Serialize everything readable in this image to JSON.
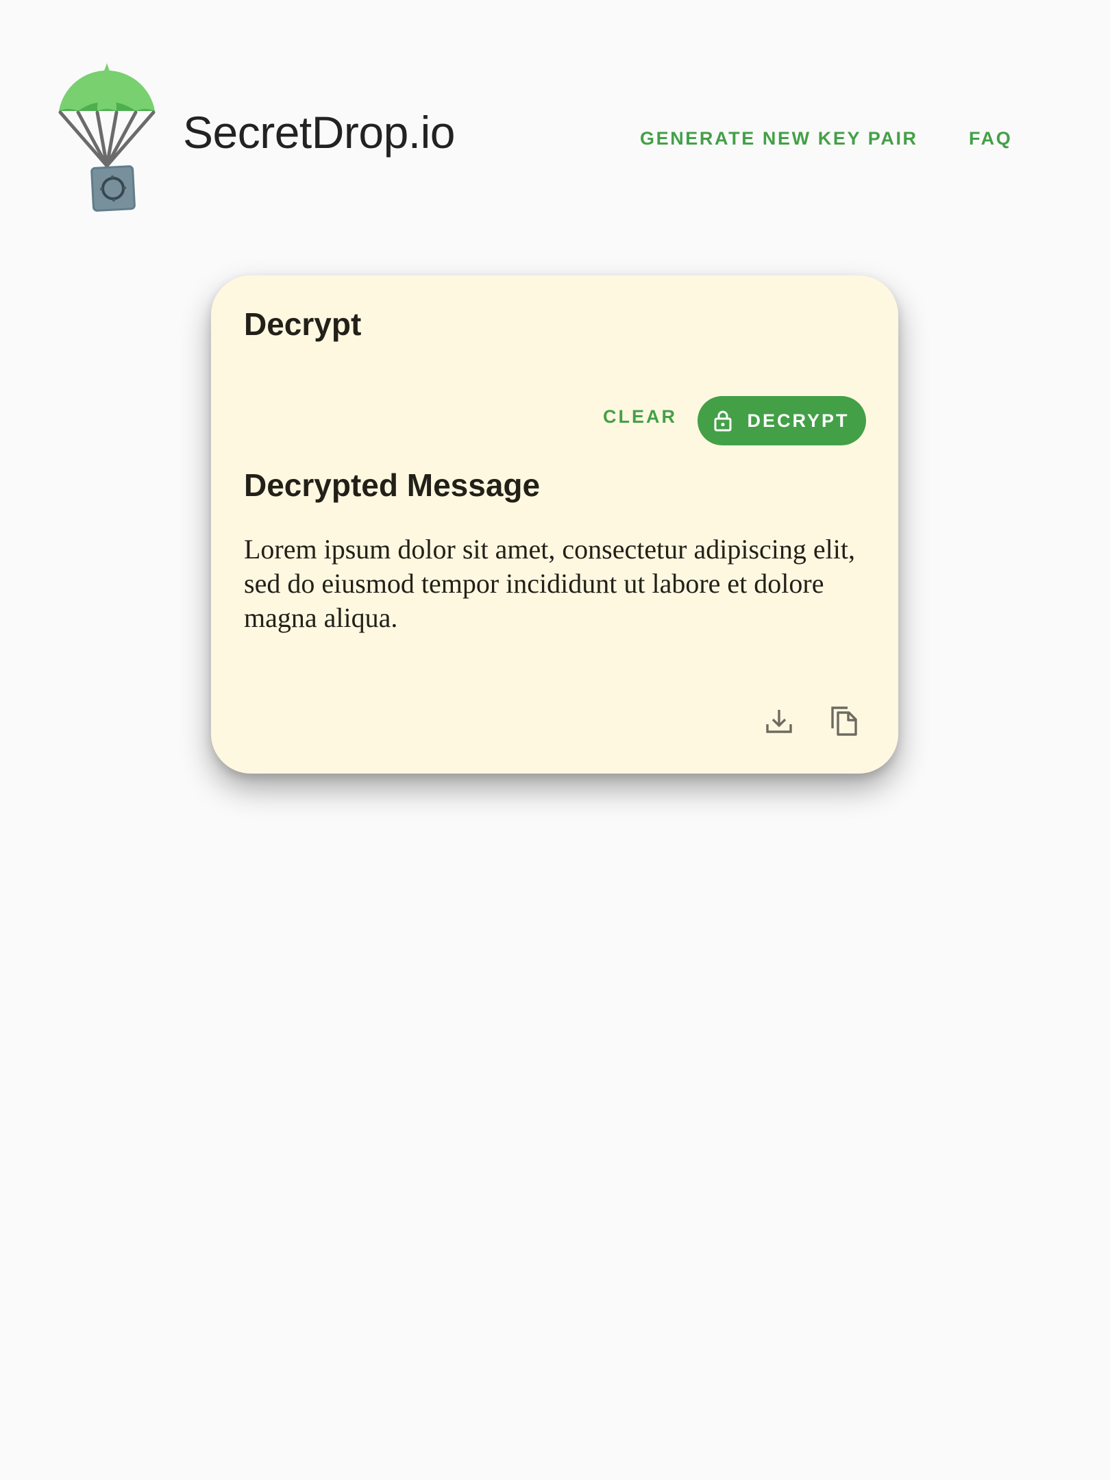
{
  "header": {
    "title": "SecretDrop.io",
    "logo_icon": "parachute-safe-icon",
    "nav": {
      "generate_label": "GENERATE NEW KEY PAIR",
      "faq_label": "FAQ"
    }
  },
  "card": {
    "title": "Decrypt",
    "actions": {
      "clear_label": "CLEAR",
      "decrypt_label": "DECRYPT",
      "decrypt_icon": "lock-icon"
    },
    "result": {
      "title": "Decrypted Message",
      "message": "Lorem ipsum dolor sit amet, consectetur adipiscing elit, sed do eiusmod tempor incididunt ut labore et dolore magna aliqua.",
      "download_icon": "download-icon",
      "copy_icon": "copy-icon"
    }
  },
  "colors": {
    "accent": "#43a047",
    "card_background": "#fff8e1",
    "page_background": "#fafafa",
    "text": "#222018"
  }
}
